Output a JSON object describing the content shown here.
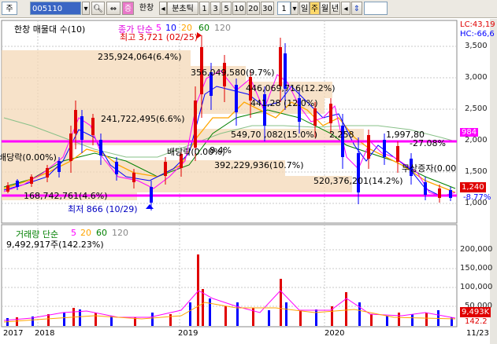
{
  "toolbar": {
    "market": "주",
    "code": "005110",
    "name": "한창",
    "periods": [
      "분초틱",
      "1",
      "3",
      "5",
      "10",
      "20",
      "30"
    ],
    "period_count": "1",
    "period_types": [
      "일",
      "주",
      "월",
      "년"
    ],
    "selected_period_type": "주",
    "icons": [
      "search-icon",
      "prev-icon",
      "next-icon",
      "gear-icon",
      "arrow-left-icon",
      "updown-icon"
    ]
  },
  "price_panel": {
    "legend_title": "한창 매물대 수(10)",
    "ma_legend": {
      "label": "종가 단순",
      "periods": [
        "5",
        "10",
        "20",
        "60",
        "120"
      ],
      "colors": [
        "#ff00ff",
        "#0000ff",
        "#ffa500",
        "#008000",
        "#888888"
      ]
    },
    "lc": "LC:43,19",
    "hc": "HC:-66,6",
    "y_ticks": [
      "3,500",
      "3,000",
      "2,500",
      "2,000",
      "1,500",
      "1,000"
    ],
    "current_price": "1,240",
    "current_change": "-8.77%",
    "line_value": "984",
    "high_label": "최고 3,721 (02/25)",
    "low_label": "최저 866 (10/29)",
    "volume_profile": [
      "235,924,064(6.4%)",
      "356,049,580(9.7%)",
      "446,069,716(12.2%)",
      "241,722,495(6.6%)",
      "441,28 (12.0%)",
      "549,70 ,082(15.0%)",
      "1,997,80",
      "392,229,936(10.7%)",
      "520,376,201(14.2%)",
      "168,742,761(4.6%)"
    ],
    "event_labels": [
      "배당락(0.00%)",
      "배당락(0.00%)",
      "무상증자(0.00",
      "2,258",
      "-27.08%",
      "8.4%"
    ],
    "accent_colors": {
      "magenta": "#ff00ff",
      "up": "#e00000",
      "down": "#0000ff"
    }
  },
  "volume_panel": {
    "legend_title": "거래량 단순",
    "ma_periods": [
      "5",
      "20",
      "60",
      "120"
    ],
    "value_text": "9,492,917주(142.23%)",
    "y_ticks": [
      "200,000",
      "150,000",
      "100,000",
      "50,000"
    ],
    "current_value": "9,493K",
    "pct": "142.2"
  },
  "x_axis": {
    "dates": [
      "2017",
      "2018",
      "2019",
      "2020",
      "11/23"
    ]
  },
  "chart_data": {
    "type": "candlestick",
    "series": [
      {
        "name": "price_close",
        "x": [
          "2017",
          "2018",
          "2019",
          "2020"
        ],
        "values": [
          1100,
          1800,
          2600,
          1240
        ]
      },
      {
        "name": "volume",
        "x": [
          "2017",
          "2018",
          "2019",
          "2020"
        ],
        "values": [
          15000,
          40000,
          225000,
          9493
        ]
      }
    ],
    "horizontal_lines": [
      1990,
      1080
    ],
    "ylim": [
      900,
      3700
    ]
  }
}
